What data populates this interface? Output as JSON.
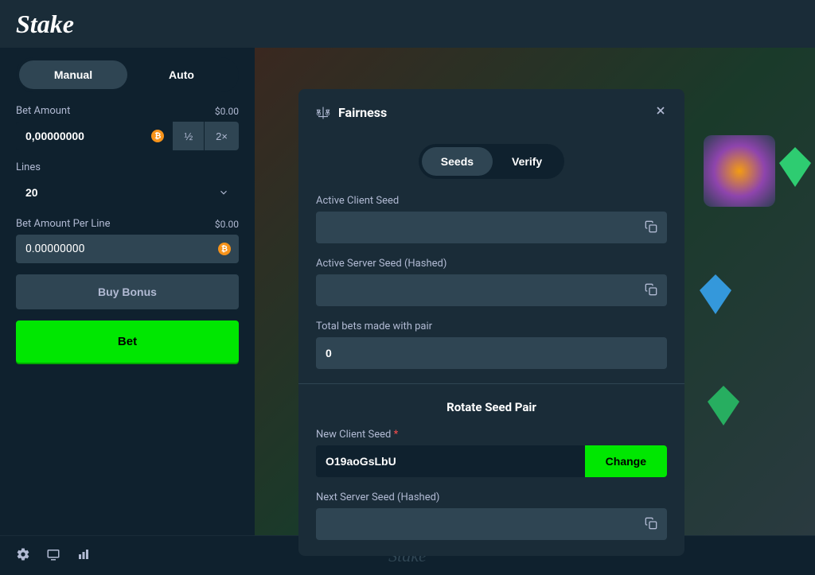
{
  "header": {
    "logo": "Stake"
  },
  "sidebar": {
    "mode": {
      "manual": "Manual",
      "auto": "Auto"
    },
    "bet_amount": {
      "label": "Bet Amount",
      "usd": "$0.00",
      "value": "0,00000000",
      "half": "½",
      "double": "2×"
    },
    "lines": {
      "label": "Lines",
      "value": "20"
    },
    "per_line": {
      "label": "Bet Amount Per Line",
      "usd": "$0.00",
      "value": "0.00000000"
    },
    "buy_bonus": "Buy Bonus",
    "bet": "Bet"
  },
  "modal": {
    "title": "Fairness",
    "tabs": {
      "seeds": "Seeds",
      "verify": "Verify"
    },
    "active_client_seed": {
      "label": "Active Client Seed",
      "value": ""
    },
    "active_server_seed": {
      "label": "Active Server Seed (Hashed)",
      "value": ""
    },
    "total_bets": {
      "label": "Total bets made with pair",
      "value": "0"
    },
    "rotate_title": "Rotate Seed Pair",
    "new_client_seed": {
      "label": "New Client Seed",
      "value": "O19aoGsLbU"
    },
    "change_btn": "Change",
    "next_server_seed": {
      "label": "Next Server Seed (Hashed)",
      "value": ""
    }
  },
  "footer": {
    "logo": "Stake"
  }
}
